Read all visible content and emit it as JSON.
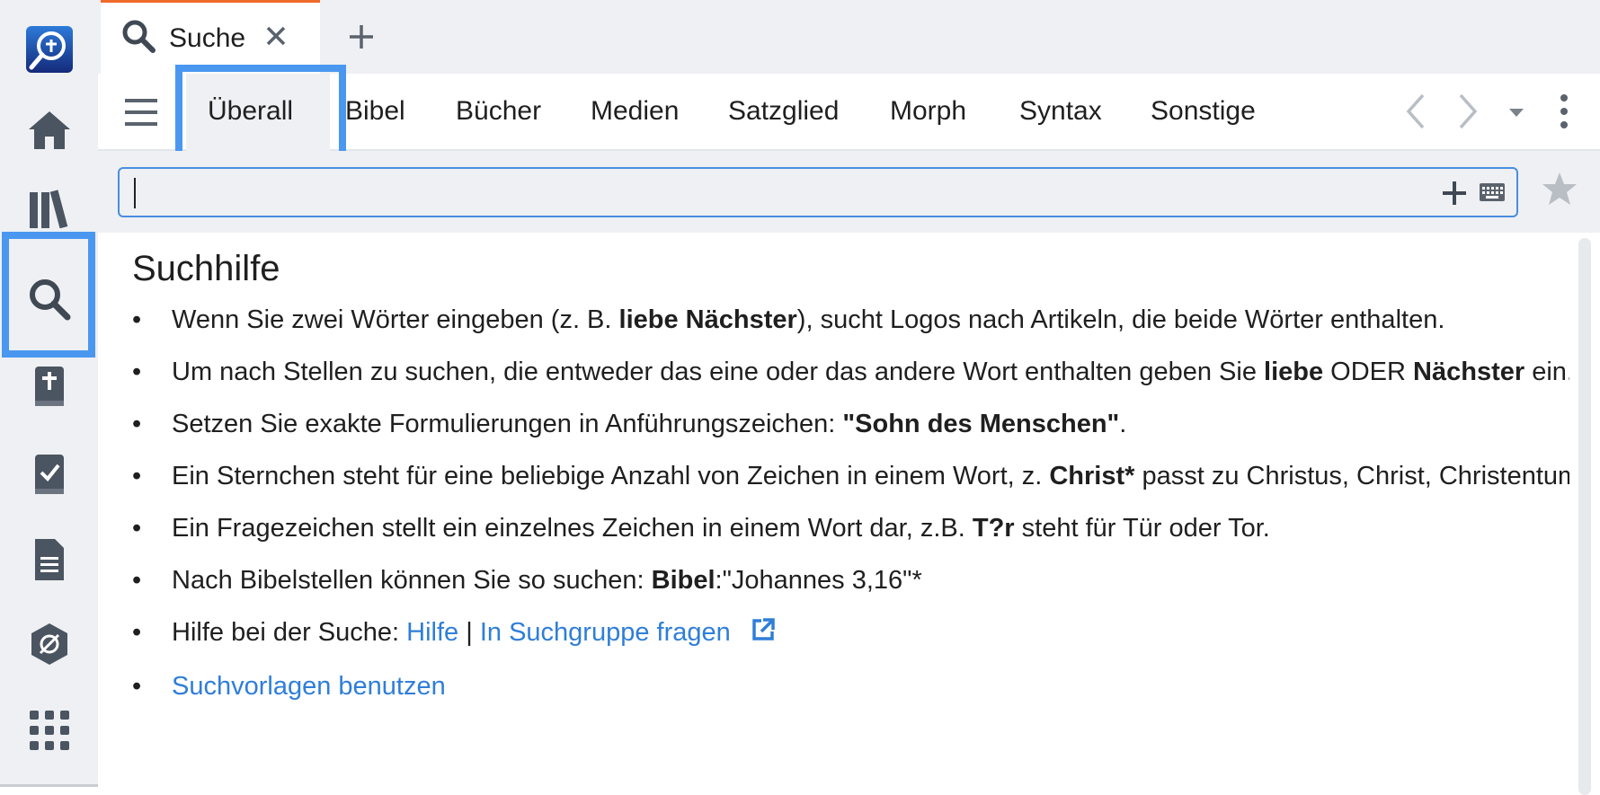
{
  "tab": {
    "title": "Suche"
  },
  "toolbar": {
    "tabs": [
      "Überall",
      "Bibel",
      "Bücher",
      "Medien",
      "Satzglied",
      "Morph",
      "Syntax",
      "Sonstige"
    ]
  },
  "search": {
    "value": "",
    "placeholder": ""
  },
  "help": {
    "heading": "Suchhilfe",
    "b1": {
      "t1": "Wenn Sie zwei Wörter eingeben (z. B. ",
      "b1": "liebe Nächster",
      "t2": "), sucht Logos nach Artikeln, die beide Wörter enthalten."
    },
    "b2": {
      "t1": "Um nach Stellen zu suchen, die entweder das eine oder das andere Wort enthalten geben Sie ",
      "b1": "liebe",
      "t2": " ODER ",
      "b2": "Nächster",
      "t3": " ein."
    },
    "b3": {
      "t1": "Setzen Sie exakte Formulierungen in Anführungszeichen: ",
      "b1": "\"Sohn des Menschen\"",
      "t2": "."
    },
    "b4": {
      "t1": "Ein Sternchen steht für eine beliebige Anzahl von Zeichen in einem Wort, z. ",
      "b1": "Christ*",
      "t2": " passt zu Christus, Christ, Christentum"
    },
    "b5": {
      "t1": "Ein Fragezeichen stellt ein einzelnes Zeichen in einem Wort dar, z.B. ",
      "b1": "T?r",
      "t2": " steht für Tür oder Tor."
    },
    "b6": {
      "t1": "Nach Bibelstellen können Sie so suchen: ",
      "b1": "Bibel",
      "t2": ":\"Johannes 3,16\"*"
    },
    "b7": {
      "t1": "Hilfe bei der Suche: ",
      "link1": "Hilfe",
      "sep": " | ",
      "link2": "In Suchgruppe fragen"
    },
    "b8": {
      "link": "Suchvorlagen benutzen"
    }
  },
  "icons": {
    "rail": [
      "logos-search-app-icon",
      "home-icon",
      "library-icon",
      "search-icon",
      "bible-icon",
      "tasks-icon",
      "document-icon",
      "visual-filter-icon",
      "apps-grid-icon"
    ]
  },
  "colors": {
    "accent": "#4a97f0",
    "link": "#2f7ed8",
    "tab_marker": "#f06a2b"
  }
}
